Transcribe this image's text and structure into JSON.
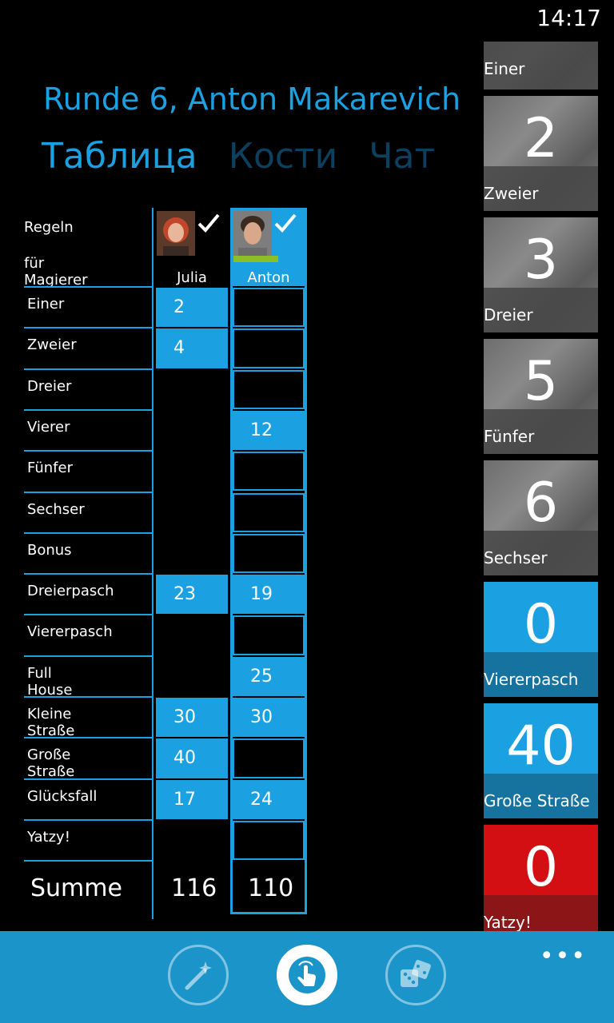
{
  "status": {
    "time": "14:17"
  },
  "header": {
    "title": "Runde 6, Anton Makarevich"
  },
  "pivot": {
    "tabs": [
      {
        "label": "Таблица"
      },
      {
        "label": "Кости"
      },
      {
        "label": "Чат"
      }
    ]
  },
  "sheet": {
    "rules_line1": "Regeln",
    "rules_line2": "für Magierer",
    "rows": [
      "Einer",
      "Zweier",
      "Dreier",
      "Vierer",
      "Fünfer",
      "Sechser",
      "Bonus",
      "Dreierpasch",
      "Viererpasch",
      "Full House",
      "Kleine Straße",
      "Große Straße",
      "Glücksfall",
      "Yatzy!"
    ],
    "summe_label": "Summe",
    "players": [
      {
        "name": "Julia",
        "checked": true,
        "scores": [
          "2",
          "4",
          "",
          "",
          "",
          "",
          "",
          "23",
          "",
          "",
          "30",
          "40",
          "17",
          ""
        ],
        "total": "116"
      },
      {
        "name": "Anton",
        "checked": true,
        "active": true,
        "scores": [
          "",
          "",
          "",
          "12",
          "",
          "",
          "",
          "19",
          "",
          "25",
          "30",
          "",
          "24",
          ""
        ],
        "total": "110"
      }
    ]
  },
  "tiles": [
    {
      "value": "",
      "label": "Einer",
      "style": "gray"
    },
    {
      "value": "2",
      "label": "Zweier",
      "style": "gray"
    },
    {
      "value": "3",
      "label": "Dreier",
      "style": "gray"
    },
    {
      "value": "5",
      "label": "Fünfer",
      "style": "gray"
    },
    {
      "value": "6",
      "label": "Sechser",
      "style": "gray"
    },
    {
      "value": "0",
      "label": "Viererpasch",
      "style": "blue"
    },
    {
      "value": "40",
      "label": "Große Straße",
      "style": "blue"
    },
    {
      "value": "0",
      "label": "Yatzy!",
      "style": "red"
    }
  ],
  "appbar": {
    "buttons": [
      {
        "icon": "magic-wand-icon"
      },
      {
        "icon": "hand-tap-icon"
      },
      {
        "icon": "dice-icon"
      }
    ],
    "more": "•••"
  }
}
